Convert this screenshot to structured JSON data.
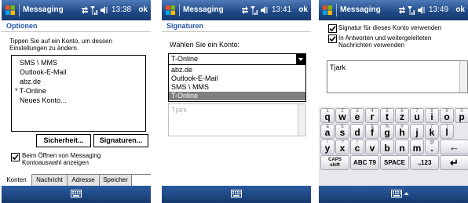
{
  "colors": {
    "titlebar": "#1e4985",
    "heading": "#2255a4",
    "selected": "#808080"
  },
  "screen1": {
    "title": "Messaging",
    "time": "13:38",
    "ok": "ok",
    "heading": "Optionen",
    "instruction": [
      "Tippen Sie auf ein Konto, um dessen",
      "Einstellungen zu ändern."
    ],
    "accounts": [
      "SMS \\ MMS",
      "Outlook-E-Mail",
      "abz.de",
      "* T-Online",
      "Neues Konto..."
    ],
    "security_button": "Sicherheit...",
    "signatures_button": "Signaturen...",
    "checkbox_checked": true,
    "checkbox_label": [
      "Beim Öffnen von Messaging",
      "Kontoauswahl anzeigen"
    ],
    "tabs": [
      "Konten",
      "Nachricht",
      "Adresse",
      "Speicher"
    ]
  },
  "screen2": {
    "title": "Messaging",
    "time": "13:41",
    "ok": "ok",
    "heading": "Signaturen",
    "prompt": "Wählen Sie ein Konto:",
    "selected_account": "T-Online",
    "options": [
      "abz.de",
      "Outlook-E-Mail",
      "SMS \\ MMS",
      "T-Online"
    ],
    "signature_text": "Tjark"
  },
  "screen3": {
    "title": "Messaging",
    "time": "13:49",
    "ok": "ok",
    "use_signature_label": "Signatur für dieses Konto verwenden",
    "use_signature_checked": true,
    "replies_label": [
      "In Antworten und weitergeleiteten",
      "Nachrichten verwenden"
    ],
    "replies_checked": true,
    "signature_text": "Tjark",
    "keyboard": {
      "row1": [
        [
          "1",
          "q"
        ],
        [
          "2",
          "w"
        ],
        [
          "3",
          "e"
        ],
        [
          "4",
          "r"
        ],
        [
          "5",
          "t"
        ],
        [
          "6",
          "z"
        ],
        [
          "7",
          "u"
        ],
        [
          "8",
          "i"
        ],
        [
          "9",
          "o"
        ],
        [
          "0",
          "p"
        ]
      ],
      "row2": [
        [
          "a",
          ""
        ],
        [
          "a",
          "s"
        ],
        [
          "d",
          ""
        ],
        [
          "&",
          "f"
        ],
        [
          "%",
          "g"
        ],
        [
          "#",
          "h"
        ],
        [
          "j",
          ""
        ],
        [
          "(",
          "k"
        ],
        [
          "",
          "l"
        ]
      ],
      "row2_display": [
        [
          "à",
          "a"
        ],
        [
          "ß",
          "s"
        ],
        [
          "",
          "d"
        ],
        [
          "&",
          "f"
        ],
        [
          "%",
          "g"
        ],
        [
          "#",
          "h"
        ],
        [
          "",
          "j"
        ],
        [
          "(",
          "k"
        ],
        [
          ")",
          "l"
        ]
      ],
      "row3": [
        [
          "!",
          "y"
        ],
        [
          "?",
          "x"
        ],
        [
          "/",
          "c"
        ],
        [
          "",
          "v"
        ],
        [
          "",
          "b"
        ],
        [
          "",
          "n"
        ],
        [
          "",
          "m"
        ],
        [
          "@",
          "."
        ]
      ],
      "caps": [
        "CAPS",
        "shift"
      ],
      "abc_t9": "ABC T9",
      "space": "SPACE",
      "symbols": ".,123"
    }
  }
}
